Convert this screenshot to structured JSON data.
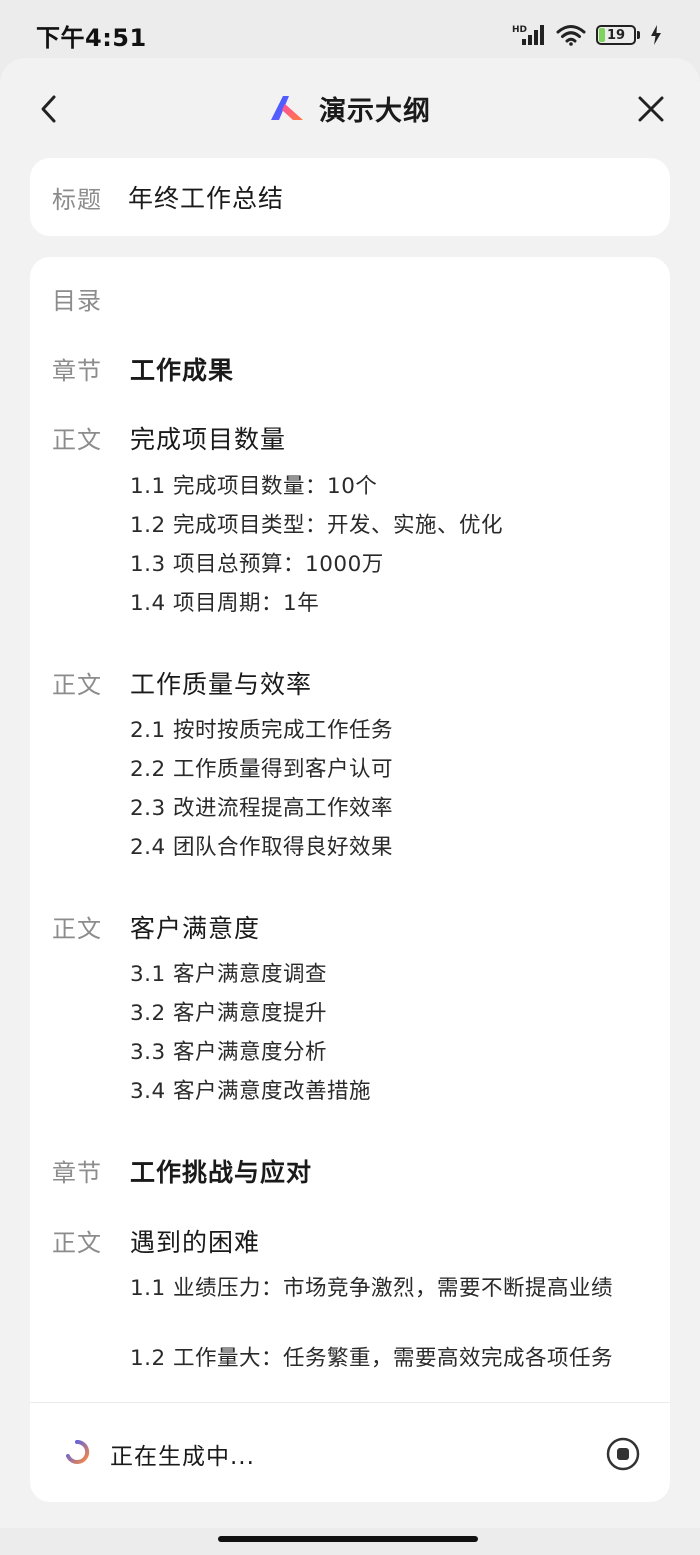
{
  "status_bar": {
    "time": "下午4:51",
    "network_label": "HD",
    "battery_level": "19",
    "battery_percent": 19
  },
  "header": {
    "title": "演示大纲",
    "logo_colors": [
      "#3b5bff",
      "#ff3d7f"
    ],
    "back_icon": "chevron-left-icon",
    "close_icon": "close-icon"
  },
  "title_card": {
    "label": "标题",
    "value": "年终工作总结"
  },
  "outline": {
    "toc_label": "目录",
    "items": [
      {
        "label": "章节",
        "text": "工作成果"
      },
      {
        "label": "正文",
        "text": "完成项目数量",
        "subs": [
          "1.1 完成项目数量：10个",
          "1.2 完成项目类型：开发、实施、优化",
          "1.3 项目总预算：1000万",
          "1.4 项目周期：1年"
        ]
      },
      {
        "label": "正文",
        "text": "工作质量与效率",
        "subs": [
          "2.1 按时按质完成工作任务",
          "2.2 工作质量得到客户认可",
          "2.3 改进流程提高工作效率",
          "2.4 团队合作取得良好效果"
        ]
      },
      {
        "label": "正文",
        "text": "客户满意度",
        "subs": [
          "3.1 客户满意度调查",
          "3.2 客户满意度提升",
          "3.3 客户满意度分析",
          "3.4 客户满意度改善措施"
        ]
      },
      {
        "label": "章节",
        "text": "工作挑战与应对"
      },
      {
        "label": "正文",
        "text": "遇到的困难",
        "subs": [
          "1.1 业绩压力：市场竞争激烈，需要不断提高业绩",
          "1.2 工作量大：任务繁重，需要高效完成各项任务"
        ]
      }
    ]
  },
  "footer": {
    "status_text": "正在生成中...",
    "spinner_colors": [
      "#3b5bff",
      "#ff8a3d"
    ],
    "stop_icon": "stop-icon"
  }
}
